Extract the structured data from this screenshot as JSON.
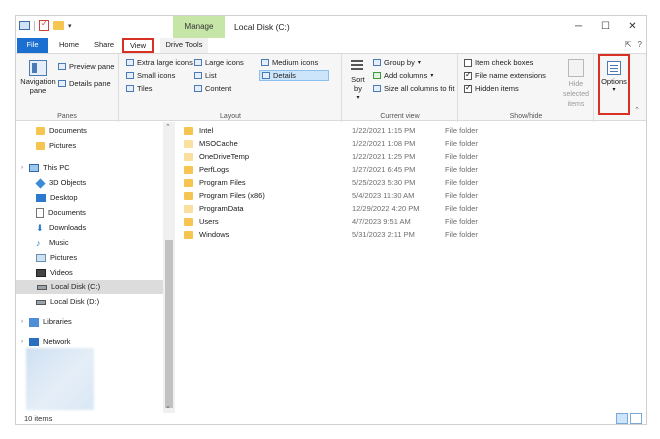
{
  "window": {
    "title": "Local Disk (C:)",
    "contextual_tab_group": "Manage",
    "controls": {
      "minimize": "─",
      "maximize": "☐",
      "close": "✕"
    }
  },
  "tabs": {
    "file": "File",
    "home": "Home",
    "share": "Share",
    "view": "View",
    "drive_tools": "Drive Tools"
  },
  "ribbon": {
    "panes": {
      "label": "Panes",
      "navigation_pane": "Navigation pane",
      "preview_pane": "Preview pane",
      "details_pane": "Details pane"
    },
    "layout": {
      "label": "Layout",
      "extra_large": "Extra large icons",
      "large": "Large icons",
      "medium": "Medium icons",
      "small": "Small icons",
      "list": "List",
      "details": "Details",
      "tiles": "Tiles",
      "content": "Content",
      "selected": "Details"
    },
    "current_view": {
      "label": "Current view",
      "sort_by": "Sort by",
      "group_by": "Group by",
      "add_columns": "Add columns",
      "size_columns": "Size all columns to fit"
    },
    "show_hide": {
      "label": "Show/hide",
      "item_checkboxes": {
        "label": "Item check boxes",
        "checked": false
      },
      "file_name_extensions": {
        "label": "File name extensions",
        "checked": true
      },
      "hidden_items": {
        "label": "Hidden items",
        "checked": true
      },
      "hide_selected": "Hide selected items"
    },
    "options": "Options"
  },
  "nav": {
    "items": [
      {
        "label": "Documents",
        "icon": "folder-icon"
      },
      {
        "label": "Pictures",
        "icon": "folder-icon"
      },
      {
        "label": "This PC",
        "icon": "computer-icon"
      },
      {
        "label": "3D Objects",
        "icon": "3d-objects-icon"
      },
      {
        "label": "Desktop",
        "icon": "desktop-icon"
      },
      {
        "label": "Documents",
        "icon": "documents-icon"
      },
      {
        "label": "Downloads",
        "icon": "download-icon"
      },
      {
        "label": "Music",
        "icon": "music-icon"
      },
      {
        "label": "Pictures",
        "icon": "pictures-icon"
      },
      {
        "label": "Videos",
        "icon": "videos-icon"
      },
      {
        "label": "Local Disk (C:)",
        "icon": "drive-icon",
        "selected": true
      },
      {
        "label": "Local Disk (D:)",
        "icon": "drive-icon"
      },
      {
        "label": "Libraries",
        "icon": "libraries-icon"
      },
      {
        "label": "Network",
        "icon": "network-icon"
      }
    ]
  },
  "files": [
    {
      "name": "Intel",
      "date": "1/22/2021 1:15 PM",
      "type": "File folder"
    },
    {
      "name": "MSOCache",
      "date": "1/22/2021 1:08 PM",
      "type": "File folder"
    },
    {
      "name": "OneDriveTemp",
      "date": "1/22/2021 1:25 PM",
      "type": "File folder"
    },
    {
      "name": "PerfLogs",
      "date": "1/27/2021 6:45 PM",
      "type": "File folder"
    },
    {
      "name": "Program Files",
      "date": "5/25/2023 5:30 PM",
      "type": "File folder"
    },
    {
      "name": "Program Files (x86)",
      "date": "5/4/2023 11:30 AM",
      "type": "File folder"
    },
    {
      "name": "ProgramData",
      "date": "12/29/2022 4:20 PM",
      "type": "File folder"
    },
    {
      "name": "Users",
      "date": "4/7/2023 9:51 AM",
      "type": "File folder"
    },
    {
      "name": "Windows",
      "date": "5/31/2023 2:11 PM",
      "type": "File folder"
    }
  ],
  "status": {
    "item_count": "10 items"
  },
  "colors": {
    "file_tab": "#1a6fd1",
    "manage_tab": "#c6e6a7",
    "highlight": "#d93025",
    "folder": "#f5c451"
  }
}
